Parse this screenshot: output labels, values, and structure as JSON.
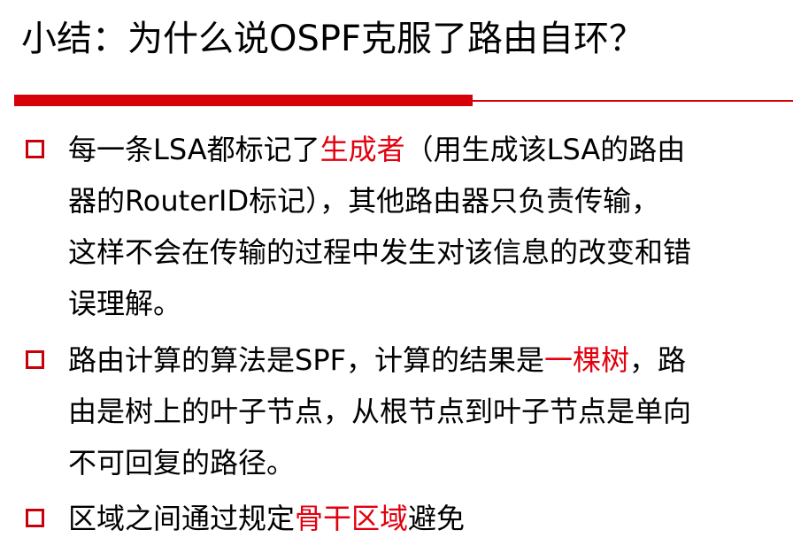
{
  "title": "小结：为什么说OSPF克服了路由自环？",
  "colors": {
    "accent_red": "#d6000a",
    "highlight_red": "#e3000f",
    "text": "#000000"
  },
  "bullets": [
    {
      "icon": "hollow-square-bullet-icon",
      "lines": [
        {
          "before": "每一条LSA都标记了",
          "highlight": "生成者",
          "after": "（用生成该LSA的路由"
        },
        "器的RouterID标记），其他路由器只负责传输，",
        "这样不会在传输的过程中发生对该信息的改变和错",
        "误理解。"
      ]
    },
    {
      "icon": "hollow-square-bullet-icon",
      "lines": [
        {
          "before": "路由计算的算法是SPF，计算的结果是",
          "highlight": "一棵树",
          "after": "，路"
        },
        "由是树上的叶子节点，从根节点到叶子节点是单向",
        "不可回复的路径。"
      ]
    },
    {
      "icon": "hollow-square-bullet-icon",
      "lines": [
        {
          "before": "区域之间通过规定",
          "highlight": "骨干区域",
          "after": "避免"
        }
      ]
    }
  ]
}
